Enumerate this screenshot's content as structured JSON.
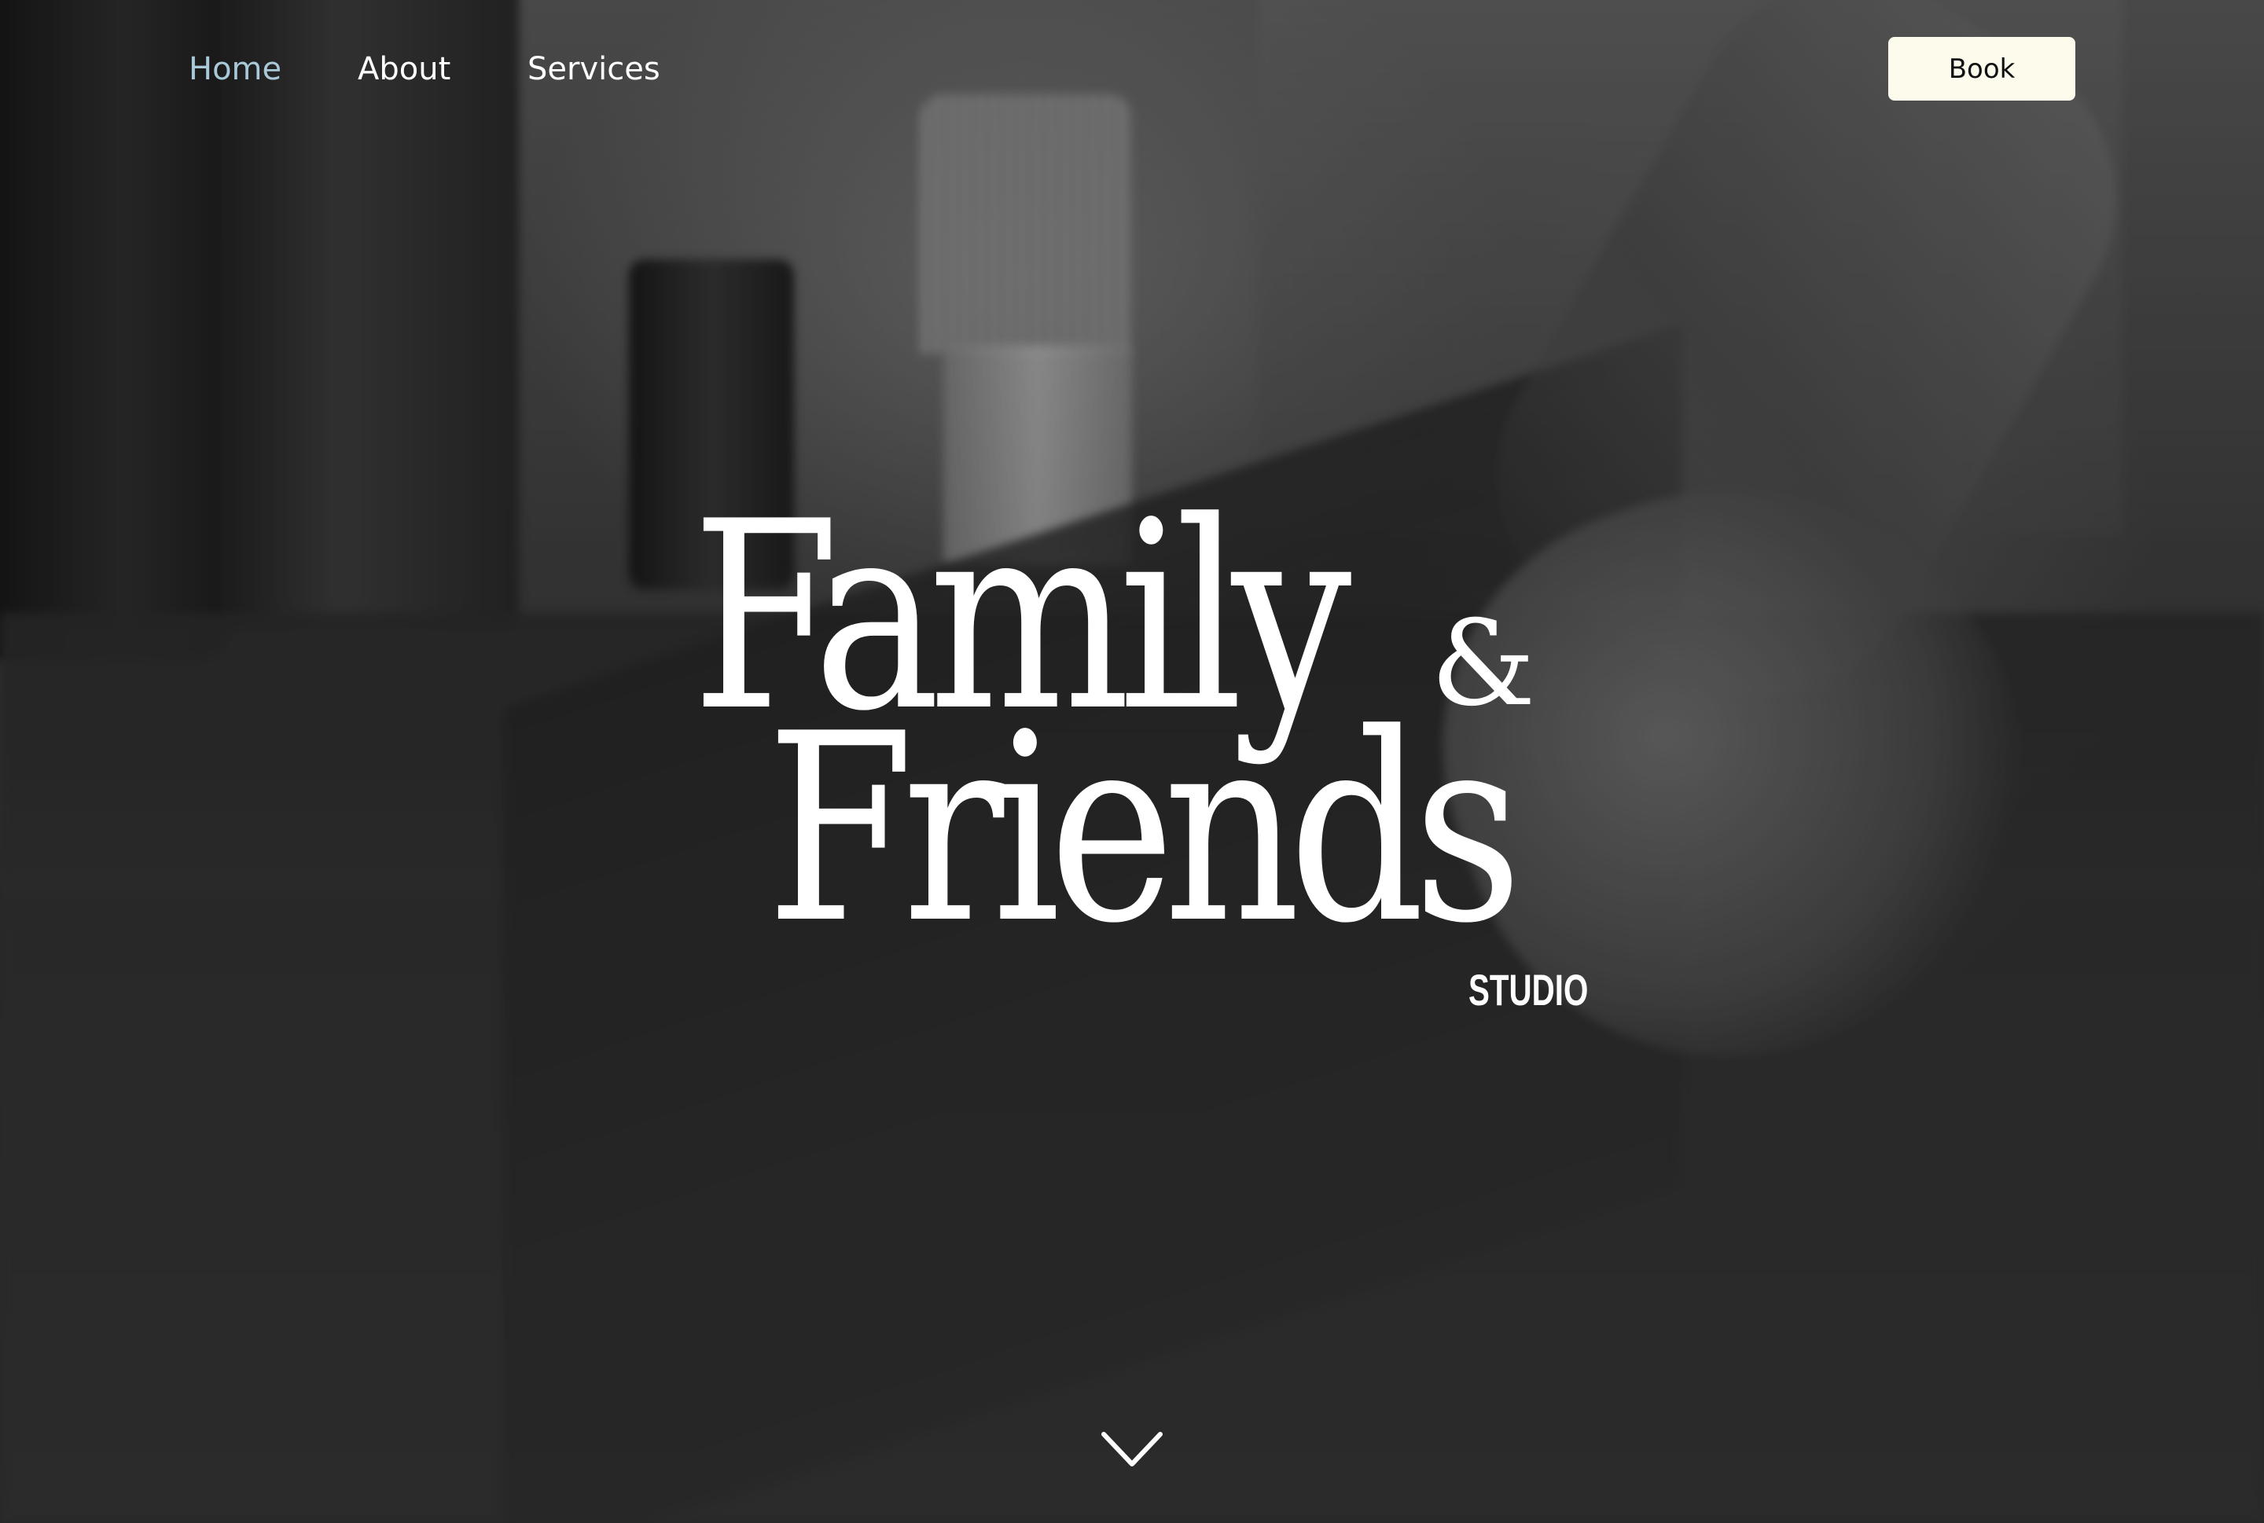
{
  "nav": {
    "items": [
      {
        "label": "Home",
        "active": true
      },
      {
        "label": "About",
        "active": false
      },
      {
        "label": "Services",
        "active": false
      }
    ],
    "book_label": "Book"
  },
  "logo": {
    "line1": "Family",
    "ampersand": "&",
    "line2": "Friends",
    "tagline": "STUDIO"
  },
  "icons": {
    "scroll": "chevron-down-icon"
  },
  "colors": {
    "active_nav": "#a9c8d8",
    "nav_text": "#ffffff",
    "book_button_bg": "#fdfbec",
    "book_button_text": "#111111"
  }
}
